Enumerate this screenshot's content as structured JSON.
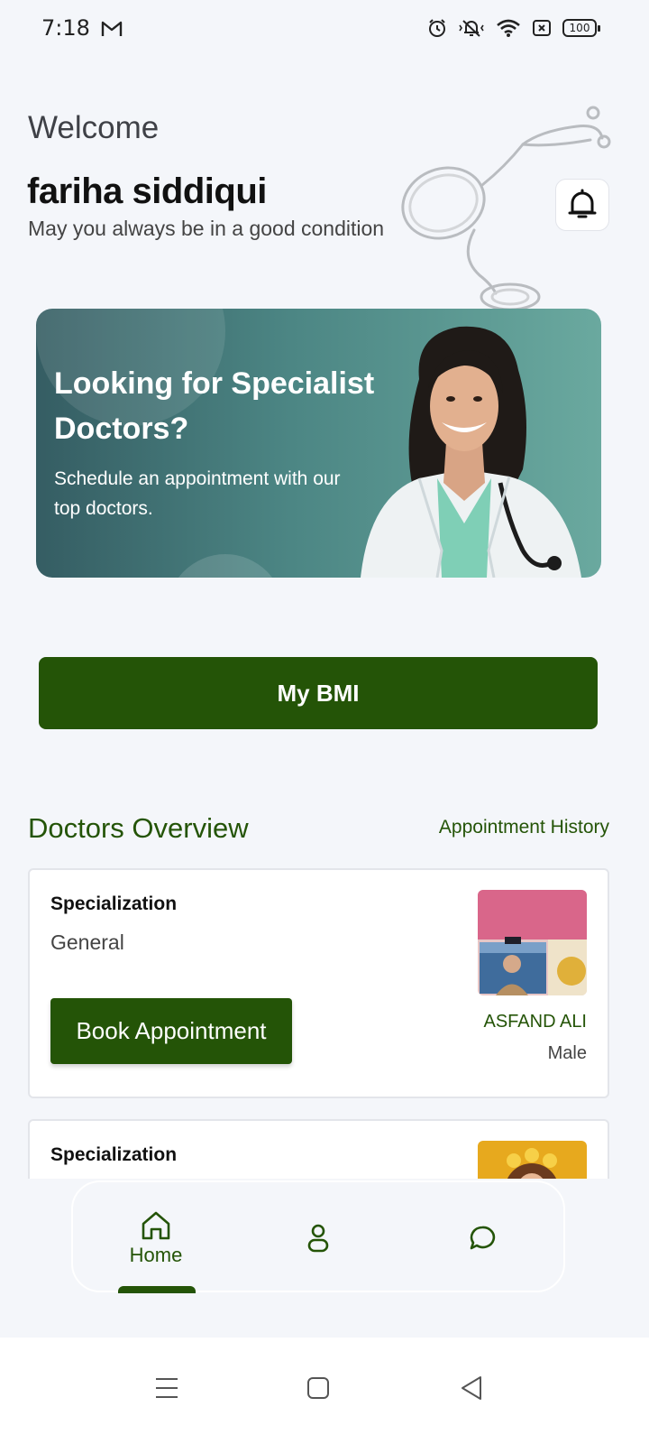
{
  "status_bar": {
    "time": "7:18",
    "battery": "100",
    "icons": [
      "gmail-icon",
      "alarm-icon",
      "vibrate-icon",
      "wifi-icon",
      "sim-x-icon",
      "battery-icon"
    ]
  },
  "header": {
    "welcome": "Welcome",
    "username": "fariha siddiqui",
    "tagline": "May you always be in a good condition",
    "notification_icon": "bell-icon"
  },
  "banner": {
    "title": "Looking for Specialist Doctors?",
    "subtitle": "Schedule an appointment with our top doctors."
  },
  "bmi_button": {
    "label": "My BMI"
  },
  "overview": {
    "title": "Doctors Overview",
    "history_link": "Appointment History"
  },
  "doctors": [
    {
      "spec_label": "Specialization",
      "specialization": "General",
      "book_label": "Book Appointment",
      "name": "ASFAND ALI",
      "gender": "Male"
    },
    {
      "spec_label": "Specialization"
    }
  ],
  "bottom_nav": {
    "items": [
      {
        "label": "Home",
        "icon": "home-icon",
        "active": true
      },
      {
        "label": "",
        "icon": "profile-icon"
      },
      {
        "label": "",
        "icon": "chat-icon"
      }
    ]
  },
  "colors": {
    "primary": "#245407",
    "background": "#f4f6fa",
    "banner": "#4c8684"
  }
}
